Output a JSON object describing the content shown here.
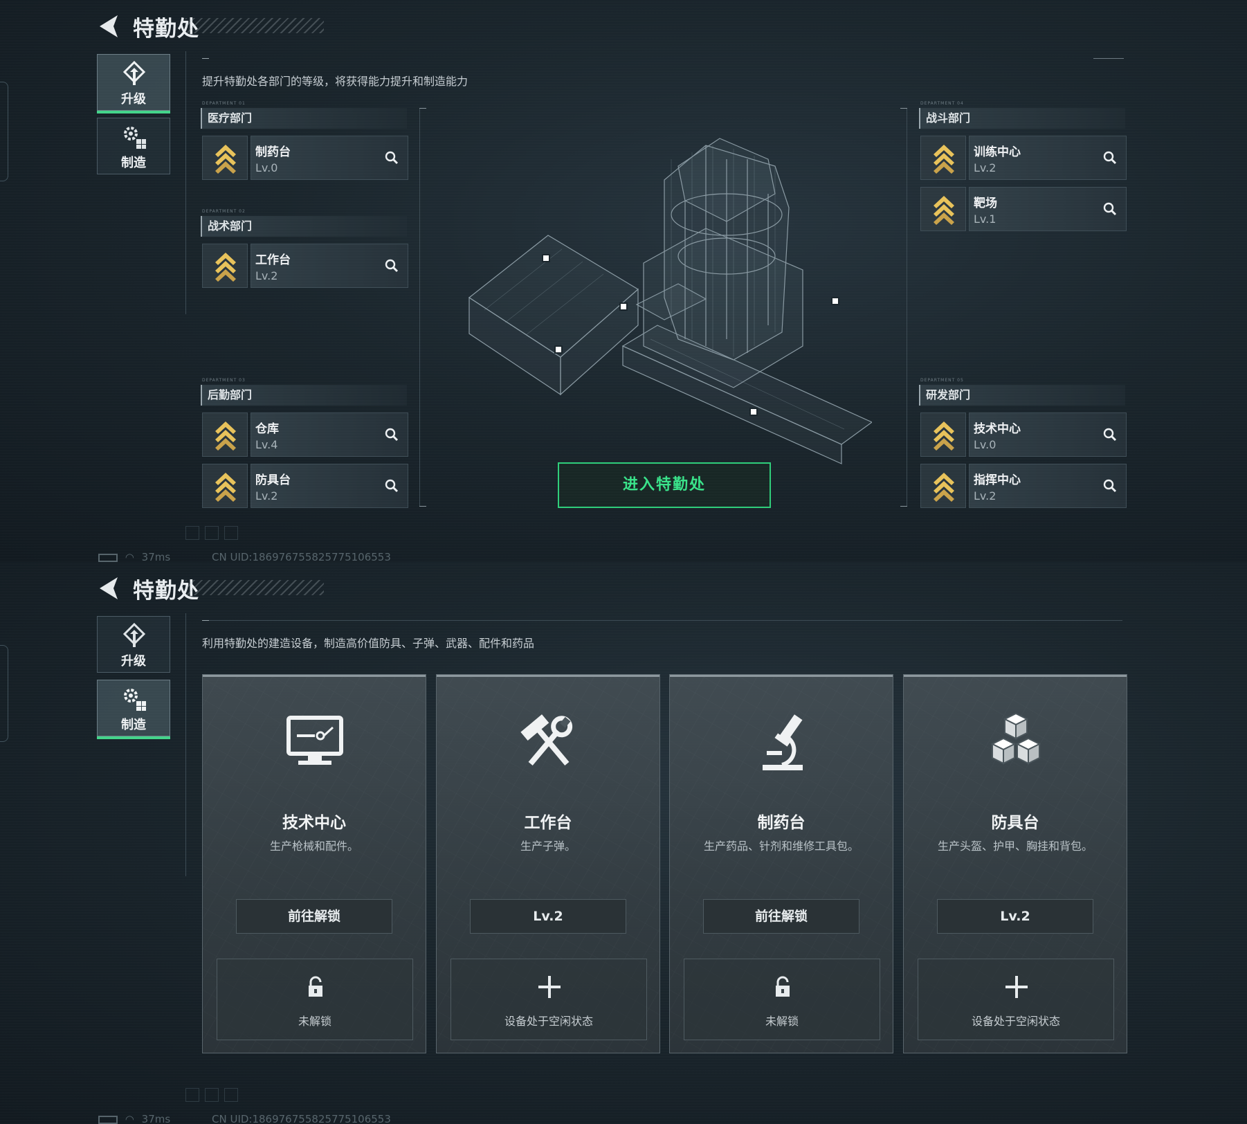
{
  "top_screen": {
    "title": "特勤处",
    "tabs": [
      {
        "label": "升级",
        "icon": "upgrade-icon",
        "active": true
      },
      {
        "label": "制造",
        "icon": "craft-gears-icon",
        "active": false
      }
    ],
    "description": "提升特勤处各部门的等级，将获得能力提升和制造能力",
    "departments": {
      "medical": {
        "title": "医疗部门",
        "items": [
          {
            "name": "制药台",
            "level": "Lv.0"
          }
        ]
      },
      "tactical": {
        "title": "战术部门",
        "items": [
          {
            "name": "工作台",
            "level": "Lv.2"
          }
        ]
      },
      "logistics": {
        "title": "后勤部门",
        "items": [
          {
            "name": "仓库",
            "level": "Lv.4"
          },
          {
            "name": "防具台",
            "level": "Lv.2"
          }
        ]
      },
      "combat": {
        "title": "战斗部门",
        "items": [
          {
            "name": "训练中心",
            "level": "Lv.2"
          },
          {
            "name": "靶场",
            "level": "Lv.1"
          }
        ]
      },
      "research": {
        "title": "研发部门",
        "items": [
          {
            "name": "技术中心",
            "level": "Lv.0"
          },
          {
            "name": "指挥中心",
            "level": "Lv.2"
          }
        ]
      }
    },
    "enter_button": "进入特勤处",
    "status": {
      "latency": "37ms",
      "uid": "CN UID:186976755825775106553"
    }
  },
  "bottom_screen": {
    "title": "特勤处",
    "tabs": [
      {
        "label": "升级",
        "icon": "upgrade-icon",
        "active": false
      },
      {
        "label": "制造",
        "icon": "craft-gears-icon",
        "active": true
      }
    ],
    "description": "利用特勤处的建造设备，制造高价值防具、子弹、武器、配件和药品",
    "cards": [
      {
        "name": "技术中心",
        "desc": "生产枪械和配件。",
        "button": "前往解锁",
        "slot_text": "未解锁",
        "icon": "monitor-icon",
        "slot_icon": "lock-icon"
      },
      {
        "name": "工作台",
        "desc": "生产子弹。",
        "button": "Lv.2",
        "slot_text": "设备处于空闲状态",
        "icon": "hammer-wrench-icon",
        "slot_icon": "plus-icon"
      },
      {
        "name": "制药台",
        "desc": "生产药品、针剂和维修工具包。",
        "button": "前往解锁",
        "slot_text": "未解锁",
        "icon": "microscope-icon",
        "slot_icon": "lock-icon"
      },
      {
        "name": "防具台",
        "desc": "生产头盔、护甲、胸挂和背包。",
        "button": "Lv.2",
        "slot_text": "设备处于空闲状态",
        "icon": "cubes-icon",
        "slot_icon": "plus-icon"
      }
    ],
    "status": {
      "latency": "37ms",
      "uid": "CN UID:186976755825775106553"
    }
  },
  "colors": {
    "accent_green": "#2fce7b",
    "rank_gold": "#e8c25a",
    "background": "#1a252c"
  }
}
